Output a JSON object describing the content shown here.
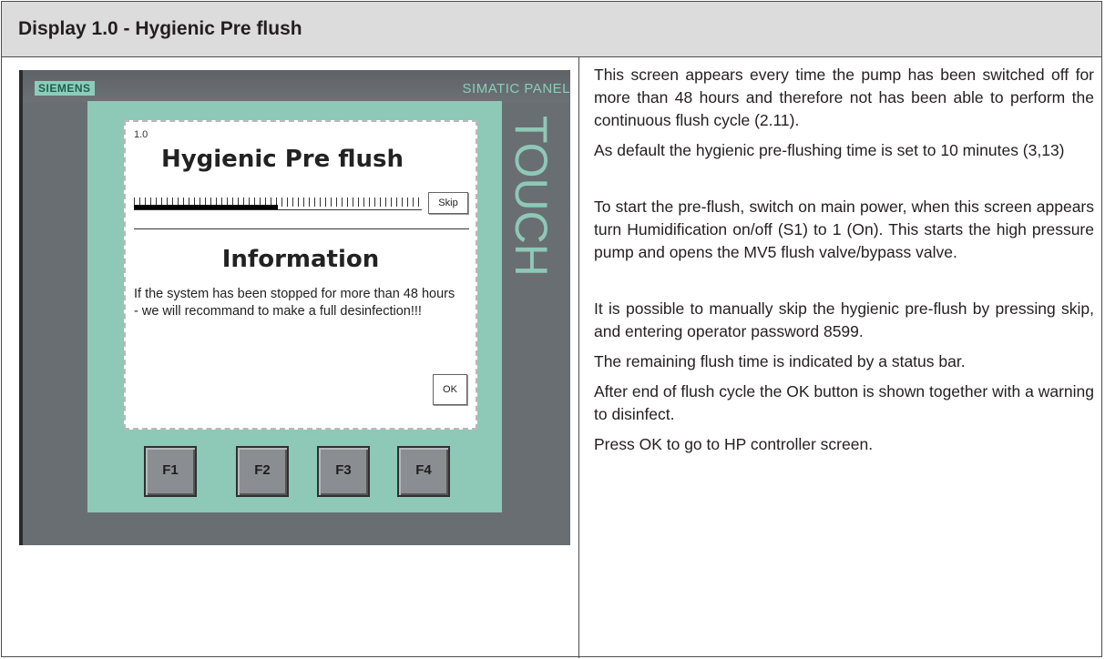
{
  "title": "Display 1.0 - Hygienic Pre flush",
  "panel": {
    "brand": "SIEMENS",
    "model": "SIMATIC PANEL",
    "touch": "TOUCH",
    "screen": {
      "id": "1.0",
      "title": "Hygienic Pre flush",
      "progress_fraction": 0.5,
      "skip_label": "Skip",
      "info_title": "Information",
      "info_text": "If the system has been stopped for more than 48 hours - we will recommand to make a full desinfection!!!",
      "ok_label": "OK"
    },
    "function_keys": [
      "F1",
      "F2",
      "F3",
      "F4"
    ]
  },
  "description": [
    "This screen appears every time the pump has been switched off for more than 48 hours and therefore not has been able to perform the continuous flush cycle (2.11).",
    "As default the hygienic pre-flushing time is set to 10 minutes (3,13)",
    "To start the pre-flush, switch on main power, when this screen appears turn Humidification on/off (S1) to 1 (On). This starts the high pressure pump and opens the MV5 flush valve/bypass valve.",
    "It is possible to manually skip the hygienic pre-flush by pressing skip, and entering operator password 8599.",
    "The remaining flush time is indicated by a status bar.",
    "After end of flush cycle the OK button is shown together with a warning to disinfect.",
    "Press OK  to go to HP controller screen."
  ]
}
